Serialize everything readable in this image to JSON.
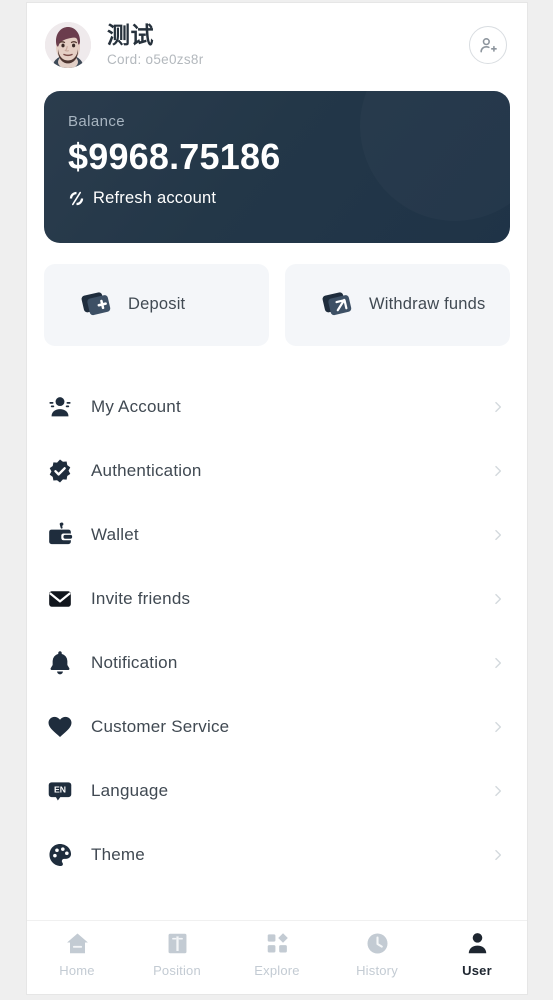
{
  "profile": {
    "name": "测试",
    "cord": "Cord: o5e0zs8r",
    "avatar_icon": "avatar-bearded-man",
    "add_user_icon": "user-plus-icon"
  },
  "balance_card": {
    "label": "Balance",
    "amount": "$9968.75186",
    "refresh_label": "Refresh account",
    "refresh_icon": "refresh-icon",
    "bg_color": "#233748",
    "text_color": "#ffffff",
    "label_color": "#a7b4c0"
  },
  "actions": [
    {
      "label": "Deposit",
      "icon": "card-plus-icon",
      "name": "deposit"
    },
    {
      "label": "Withdraw funds",
      "icon": "card-arrow-icon",
      "name": "withdraw-funds"
    }
  ],
  "menu": {
    "chevron_icon": "chevron-right-icon",
    "items": [
      {
        "label": "My Account",
        "icon": "person-icon",
        "name": "my-account"
      },
      {
        "label": "Authentication",
        "icon": "verified-badge-icon",
        "name": "authentication"
      },
      {
        "label": "Wallet",
        "icon": "wallet-icon",
        "name": "wallet"
      },
      {
        "label": "Invite friends",
        "icon": "envelope-icon",
        "name": "invite-friends"
      },
      {
        "label": "Notification",
        "icon": "bell-icon",
        "name": "notification"
      },
      {
        "label": "Customer Service",
        "icon": "heart-icon",
        "name": "customer-service"
      },
      {
        "label": "Language",
        "icon": "language-en-icon",
        "name": "language",
        "badge": "EN"
      },
      {
        "label": "Theme",
        "icon": "palette-icon",
        "name": "theme"
      }
    ]
  },
  "bottom_nav": {
    "active": "User",
    "items": [
      {
        "label": "Home",
        "icon": "home-icon",
        "active": false
      },
      {
        "label": "Position",
        "icon": "book-icon",
        "active": false
      },
      {
        "label": "Explore",
        "icon": "grid-icon",
        "active": false
      },
      {
        "label": "History",
        "icon": "clock-icon",
        "active": false
      },
      {
        "label": "User",
        "icon": "user-icon",
        "active": true
      }
    ]
  },
  "colors": {
    "accent_dark": "#233748",
    "icon_dark": "#1f2d3d",
    "text_primary": "#404952",
    "text_muted": "#b3b8bd",
    "nav_inactive": "#c3cbd3",
    "tile_bg": "#f4f6f9",
    "page_bg": "#efefef"
  }
}
